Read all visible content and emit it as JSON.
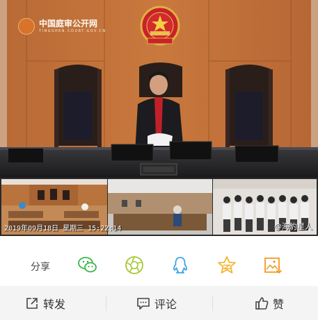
{
  "video": {
    "watermark_title": "中国庭审公开网",
    "watermark_subtitle": "TINGSHEN.COURT.GOV.CN",
    "timestamp": "2019年09月18日 星期三 15:22:14",
    "credit": "@海豹星人"
  },
  "share_bar": {
    "label": "分享",
    "icons": [
      "wechat-icon",
      "moments-icon",
      "qq-icon",
      "qzone-icon",
      "save-image-icon"
    ]
  },
  "actions": {
    "repost": "转发",
    "comment": "评论",
    "like": "赞"
  },
  "colors": {
    "accent_blue": "#2e8bd8",
    "wechat_green": "#39b54a",
    "moments_green": "#a5c832",
    "qq_blue": "#3ba4e8",
    "qzone_yellow": "#f2b631",
    "save_orange": "#f29b22"
  }
}
